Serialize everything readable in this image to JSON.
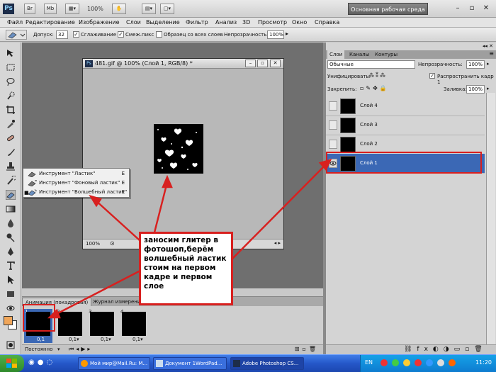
{
  "titlebar": {
    "logo": "Ps",
    "mb_label": "Mb",
    "zoom": "100%",
    "workspace": "Основная рабочая среда"
  },
  "menu": [
    "Файл",
    "Редактирование",
    "Изображение",
    "Слои",
    "Выделение",
    "Фильтр",
    "Анализ",
    "3D",
    "Просмотр",
    "Окно",
    "Справка"
  ],
  "options": {
    "tolerance_label": "Допуск:",
    "tolerance_value": "32",
    "antialias": "Сглаживание",
    "contiguous": "Смеж.пикс",
    "sample_all": "Образец со всех слоев",
    "opacity_label": "Непрозрачность:",
    "opacity_value": "100%"
  },
  "document": {
    "title": "481.gif @ 100% (Слой 1, RGB/8) *",
    "zoom": "100%"
  },
  "context_menu": [
    {
      "label": "Инструмент \"Ластик\"",
      "key": "E",
      "selected": false
    },
    {
      "label": "Инструмент \"Фоновый ластик\"",
      "key": "E",
      "selected": false
    },
    {
      "label": "Инструмент \"Волшебный ластик\"",
      "key": "E",
      "selected": true
    }
  ],
  "animation": {
    "tab_active": "Анимация (покадровая)",
    "tab_other": "Журнал измерений",
    "frames": [
      {
        "num": "1",
        "dur": "0,1"
      },
      {
        "num": "2",
        "dur": "0,1▾"
      },
      {
        "num": "3",
        "dur": "0,1▾"
      },
      {
        "num": "4",
        "dur": "0,1▾"
      }
    ],
    "loop": "Постоянно"
  },
  "layers_panel": {
    "tabs": [
      "Слои",
      "Каналы",
      "Контуры"
    ],
    "blend_mode": "Обычные",
    "opacity_label": "Непрозрачность:",
    "opacity_value": "100%",
    "unify_label": "Унифицировать:",
    "propagate": "Распространить кадр 1",
    "lock_label": "Закрепить:",
    "fill_label": "Заливка:",
    "fill_value": "100%",
    "layers": [
      {
        "name": "Слой 4",
        "selected": false
      },
      {
        "name": "Слой 3",
        "selected": false
      },
      {
        "name": "Слой 2",
        "selected": false
      },
      {
        "name": "Слой 1",
        "selected": true
      }
    ]
  },
  "annotation": {
    "text": "заносим глитер в фотошоп,берём волшебный ластик стоим на первом кадре и первом слое"
  },
  "taskbar": {
    "tasks": [
      {
        "label": "Мой мир@Mail.Ru: М..."
      },
      {
        "label": "Документ 1WordPad..."
      },
      {
        "label": "Adobe Photoshop CS..."
      }
    ],
    "lang": "EN",
    "clock": "11:20"
  },
  "colors": {
    "accent_red": "#d8201f",
    "selection_blue": "#3b68b5",
    "foreground_swatch": "#f0a65a"
  }
}
